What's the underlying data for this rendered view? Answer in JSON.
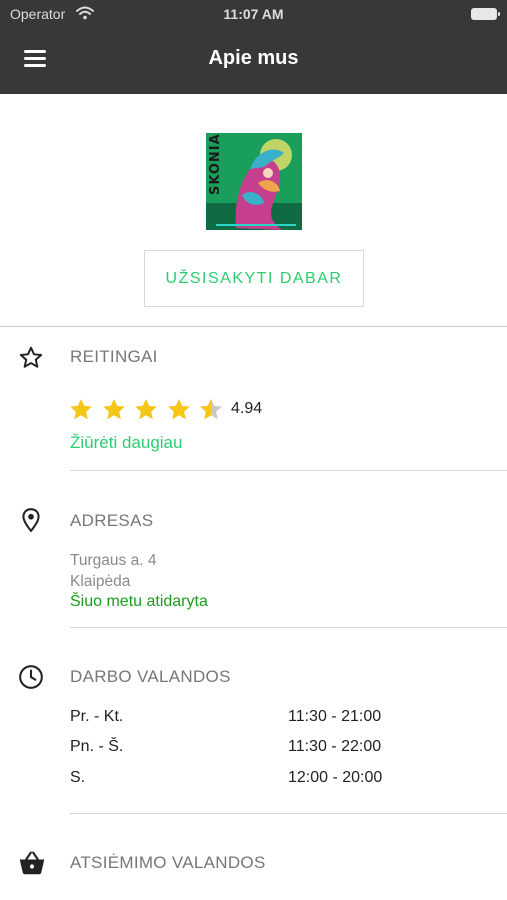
{
  "status_bar": {
    "carrier": "Operator",
    "time": "11:07 AM"
  },
  "nav": {
    "title": "Apie mus",
    "menu_icon": "hamburger-menu-icon"
  },
  "logo": {
    "text": "SKONIAI",
    "colors": {
      "bg": "#1a9e5c",
      "accent": "#c63f8f",
      "sky": "#3ab0c9"
    }
  },
  "order_button": {
    "label": "UŽSISAKYTI DABAR"
  },
  "ratings": {
    "heading": "REITINGAI",
    "icon": "star-outline-icon",
    "value": "4.94",
    "stars_filled": 4.5,
    "stars_total": 5,
    "more_link": "Žiūrėti daugiau"
  },
  "address": {
    "heading": "ADRESAS",
    "icon": "location-pin-icon",
    "street": "Turgaus a. 4",
    "city": "Klaipėda",
    "status": "Šiuo metu atidaryta"
  },
  "work_hours": {
    "heading": "DARBO VALANDOS",
    "icon": "clock-icon",
    "rows": [
      {
        "day": "Pr. - Kt.",
        "time": "11:30 - 21:00"
      },
      {
        "day": "Pn. - Š.",
        "time": "11:30 - 22:00"
      },
      {
        "day": "S.",
        "time": "12:00 - 20:00"
      }
    ]
  },
  "pickup_hours": {
    "heading": "ATSIĖMIMO VALANDOS",
    "icon": "basket-icon"
  },
  "colors": {
    "accent_green": "#2ecc71",
    "open_green": "#1e9a1e",
    "star_gold": "#f5c518",
    "bar_bg": "#383838"
  }
}
